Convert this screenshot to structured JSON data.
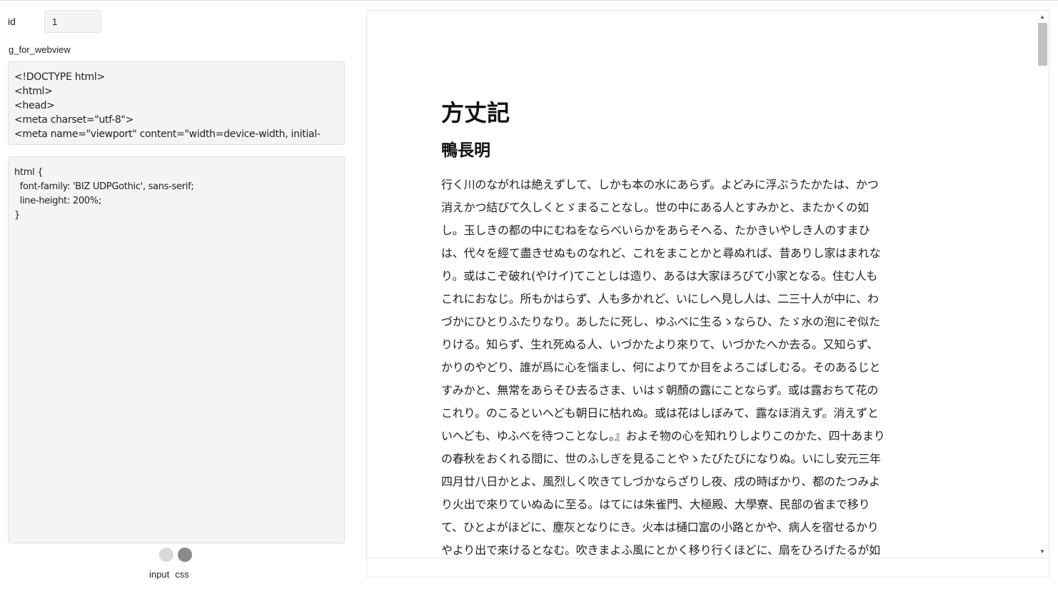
{
  "form": {
    "id_label": "id",
    "id_value": "1",
    "g_for_webview_label": "g_for_webview"
  },
  "html_code": "<!DOCTYPE html>\n<html>\n<head>\n<meta charset=\"utf-8\">\n<meta name=\"viewport\" content=\"width=device-width, initial-",
  "css_code": "html {\n  font-family: 'BIZ UDPGothic', sans-serif;\n  line-height: 200%;\n}",
  "tabs": {
    "input_label": "input",
    "css_label": "css"
  },
  "webview": {
    "title": "方丈記",
    "author": "鴨長明",
    "body": "行く川のながれは絶えずして、しかも本の水にあらず。よどみに浮ぶうたかたは、かつ消えかつ結びて久しくとゞまることなし。世の中にある人とすみかと、またかくの如し。玉しきの都の中にむねをならべいらかをあらそへる、たかきいやしき人のすまひは、代々を經て盡きせぬものなれど、これをまことかと尋ぬれば、昔ありし家はまれなり。或はこぞ破れ(やけイ)てことしは造り、あるは大家ほろびて小家となる。住む人もこれにおなじ。所もかはらず、人も多かれど、いにしへ見し人は、二三十人が中に、わづかにひとりふたりなり。あしたに死し、ゆふべに生るゝならひ、たゞ水の泡にぞ似たりける。知らず、生れ死ぬる人、いづかたより來りて、いづかたへか去る。又知らず、かりのやどり、誰が爲に心を惱まし、何によりてか目をよろこばしむる。そのあるじとすみかと、無常をあらそひ去るさま、いはゞ朝顏の露にことならず。或は露おちて花のこれり。のこるといへども朝日に枯れぬ。或は花はしぼみて、露なほ消えず。消えずといへども、ゆふべを待つことなし。』およそ物の心を知れりしよりこのかた、四十あまりの春秋をおくれる間に、世のふしぎを見ることやゝたびたびになりぬ。いにし安元三年四月廿八日かとよ、風烈しく吹きてしづかならざりし夜、戌の時ばかり、都のたつみより火出で來りていぬゐに至る。はてには朱雀門、大極殿、大學寮、民部の省まで移りて、ひとよがほどに、塵灰となりにき。火本は樋口富の小路とかや、病人を宿せるかりやより出で來けるとなむ。吹きまよふ風にとかく移り行くほどに、扇をひろげたるが如くすゑひろになりぬ。遠き家は煙にむせび、近きあたりはひたすらほのほを地に吹きつ"
  },
  "scrollbar": {
    "up_icon": "▲",
    "down_icon": "▼"
  }
}
